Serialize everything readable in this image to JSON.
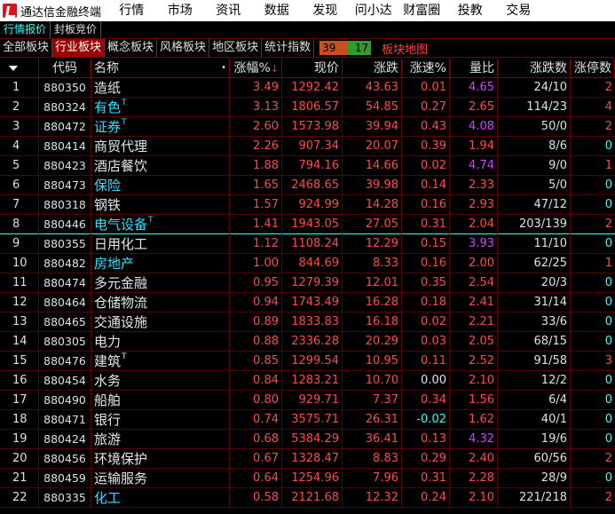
{
  "app_title": "通达信金融终端",
  "menu": [
    "行情",
    "市场",
    "资讯",
    "数据",
    "发现",
    "问小达",
    "财富圈",
    "投教",
    "交易"
  ],
  "subtabs": [
    "行情报价",
    "封板竞价"
  ],
  "categories": [
    "全部板块",
    "行业板块",
    "概念板块",
    "风格板块",
    "地区板块",
    "统计指数"
  ],
  "active_category": 1,
  "advance_count": "39",
  "decline_count": "17",
  "heatmap_link": "板块地图",
  "columns": {
    "code": "代码",
    "name": "称",
    "name_prefix": "名",
    "dot": "•",
    "pct": "涨幅%",
    "sort": "↓",
    "price": "现价",
    "chg": "涨跌",
    "spd": "涨速%",
    "vr": "量比",
    "ud": "涨跌数",
    "lu": "涨停数"
  },
  "rows": [
    {
      "idx": "1",
      "code": "880350",
      "name": "造纸",
      "flag": "",
      "hl": false,
      "pct": "3.49",
      "price": "1292.42",
      "chg": "43.63",
      "spd": "0.01",
      "vr": "4.65",
      "vr_c": "mag",
      "spd_c": "red",
      "ud": "24/10",
      "lu": "2"
    },
    {
      "idx": "2",
      "code": "880324",
      "name": "有色",
      "flag": "T",
      "hl": true,
      "pct": "3.13",
      "price": "1806.57",
      "chg": "54.85",
      "spd": "0.27",
      "vr": "2.65",
      "vr_c": "red",
      "spd_c": "red",
      "ud": "114/23",
      "lu": "4"
    },
    {
      "idx": "3",
      "code": "880472",
      "name": "证券",
      "flag": "T",
      "hl": true,
      "pct": "2.60",
      "price": "1573.98",
      "chg": "39.94",
      "spd": "0.43",
      "vr": "4.08",
      "vr_c": "mag",
      "spd_c": "red",
      "ud": "50/0",
      "lu": "2"
    },
    {
      "idx": "4",
      "code": "880414",
      "name": "商贸代理",
      "flag": "",
      "hl": false,
      "pct": "2.26",
      "price": "907.34",
      "chg": "20.07",
      "spd": "0.39",
      "vr": "1.94",
      "vr_c": "red",
      "spd_c": "red",
      "ud": "8/6",
      "lu": "0"
    },
    {
      "idx": "5",
      "code": "880423",
      "name": "酒店餐饮",
      "flag": "",
      "hl": false,
      "pct": "1.88",
      "price": "794.16",
      "chg": "14.66",
      "spd": "0.02",
      "vr": "4.74",
      "vr_c": "mag",
      "spd_c": "red",
      "ud": "9/0",
      "lu": "1"
    },
    {
      "idx": "6",
      "code": "880473",
      "name": "保险",
      "flag": "",
      "hl": true,
      "pct": "1.65",
      "price": "2468.65",
      "chg": "39.98",
      "spd": "0.14",
      "vr": "2.33",
      "vr_c": "red",
      "spd_c": "red",
      "ud": "5/0",
      "lu": "0"
    },
    {
      "idx": "7",
      "code": "880318",
      "name": "钢铁",
      "flag": "",
      "hl": false,
      "pct": "1.57",
      "price": "924.99",
      "chg": "14.28",
      "spd": "0.16",
      "vr": "2.93",
      "vr_c": "red",
      "spd_c": "red",
      "ud": "47/12",
      "lu": "0"
    },
    {
      "idx": "8",
      "code": "880446",
      "name": "电气设备",
      "flag": "T",
      "hl": true,
      "pct": "1.41",
      "price": "1943.05",
      "chg": "27.05",
      "spd": "0.31",
      "vr": "2.04",
      "vr_c": "red",
      "spd_c": "red",
      "ud": "203/139",
      "lu": "2"
    },
    {
      "idx": "9",
      "code": "880355",
      "name": "日用化工",
      "flag": "",
      "hl": false,
      "pct": "1.12",
      "price": "1108.24",
      "chg": "12.29",
      "spd": "0.15",
      "vr": "3.93",
      "vr_c": "mag",
      "spd_c": "red",
      "ud": "11/10",
      "lu": "0"
    },
    {
      "idx": "10",
      "code": "880482",
      "name": "房地产",
      "flag": "",
      "hl": true,
      "pct": "1.00",
      "price": "844.69",
      "chg": "8.33",
      "spd": "0.16",
      "vr": "2.00",
      "vr_c": "red",
      "spd_c": "red",
      "ud": "62/25",
      "lu": "1"
    },
    {
      "idx": "11",
      "code": "880474",
      "name": "多元金融",
      "flag": "",
      "hl": false,
      "pct": "0.95",
      "price": "1279.39",
      "chg": "12.01",
      "spd": "0.35",
      "vr": "2.54",
      "vr_c": "red",
      "spd_c": "red",
      "ud": "20/3",
      "lu": "0"
    },
    {
      "idx": "12",
      "code": "880464",
      "name": "仓储物流",
      "flag": "",
      "hl": false,
      "pct": "0.94",
      "price": "1743.49",
      "chg": "16.28",
      "spd": "0.18",
      "vr": "2.41",
      "vr_c": "red",
      "spd_c": "red",
      "ud": "31/14",
      "lu": "0"
    },
    {
      "idx": "13",
      "code": "880465",
      "name": "交通设施",
      "flag": "",
      "hl": false,
      "pct": "0.89",
      "price": "1833.83",
      "chg": "16.18",
      "spd": "0.02",
      "vr": "2.21",
      "vr_c": "red",
      "spd_c": "red",
      "ud": "33/6",
      "lu": "0"
    },
    {
      "idx": "14",
      "code": "880305",
      "name": "电力",
      "flag": "",
      "hl": false,
      "pct": "0.88",
      "price": "2336.28",
      "chg": "20.29",
      "spd": "0.03",
      "vr": "2.05",
      "vr_c": "red",
      "spd_c": "red",
      "ud": "68/15",
      "lu": "0"
    },
    {
      "idx": "15",
      "code": "880476",
      "name": "建筑",
      "flag": "T",
      "hl": false,
      "pct": "0.85",
      "price": "1299.54",
      "chg": "10.95",
      "spd": "0.11",
      "vr": "2.52",
      "vr_c": "red",
      "spd_c": "red",
      "ud": "91/58",
      "lu": "3"
    },
    {
      "idx": "16",
      "code": "880454",
      "name": "水务",
      "flag": "",
      "hl": false,
      "pct": "0.84",
      "price": "1283.21",
      "chg": "10.70",
      "spd": "0.00",
      "vr": "2.10",
      "vr_c": "red",
      "spd_c": "white",
      "ud": "12/2",
      "lu": "0"
    },
    {
      "idx": "17",
      "code": "880490",
      "name": "船舶",
      "flag": "",
      "hl": false,
      "pct": "0.80",
      "price": "929.71",
      "chg": "7.37",
      "spd": "0.34",
      "vr": "1.56",
      "vr_c": "red",
      "spd_c": "red",
      "ud": "6/4",
      "lu": "0"
    },
    {
      "idx": "18",
      "code": "880471",
      "name": "银行",
      "flag": "",
      "hl": false,
      "pct": "0.74",
      "price": "3575.71",
      "chg": "26.31",
      "spd": "-0.02",
      "vr": "1.62",
      "vr_c": "red",
      "spd_c": "cyan",
      "ud": "40/1",
      "lu": "0"
    },
    {
      "idx": "19",
      "code": "880424",
      "name": "旅游",
      "flag": "",
      "hl": false,
      "pct": "0.68",
      "price": "5384.29",
      "chg": "36.41",
      "spd": "0.13",
      "vr": "4.32",
      "vr_c": "mag",
      "spd_c": "red",
      "ud": "19/6",
      "lu": "0"
    },
    {
      "idx": "20",
      "code": "880456",
      "name": "环境保护",
      "flag": "",
      "hl": false,
      "pct": "0.67",
      "price": "1328.47",
      "chg": "8.83",
      "spd": "0.29",
      "vr": "2.40",
      "vr_c": "red",
      "spd_c": "red",
      "ud": "60/56",
      "lu": "2"
    },
    {
      "idx": "21",
      "code": "880459",
      "name": "运输服务",
      "flag": "",
      "hl": false,
      "pct": "0.64",
      "price": "1254.96",
      "chg": "7.96",
      "spd": "0.31",
      "vr": "2.28",
      "vr_c": "red",
      "spd_c": "red",
      "ud": "28/9",
      "lu": "0"
    },
    {
      "idx": "22",
      "code": "880335",
      "name": "化工",
      "flag": "",
      "hl": true,
      "pct": "0.58",
      "price": "2121.68",
      "chg": "12.32",
      "spd": "0.24",
      "vr": "2.10",
      "vr_c": "red",
      "spd_c": "red",
      "ud": "221/218",
      "lu": "2"
    }
  ],
  "colors": {
    "up": "#ff4a4a",
    "down": "#33ffff",
    "volume_high": "#d040ff",
    "highlight_name": "#33e0ff",
    "active_tab_bg": "#9a0000"
  }
}
